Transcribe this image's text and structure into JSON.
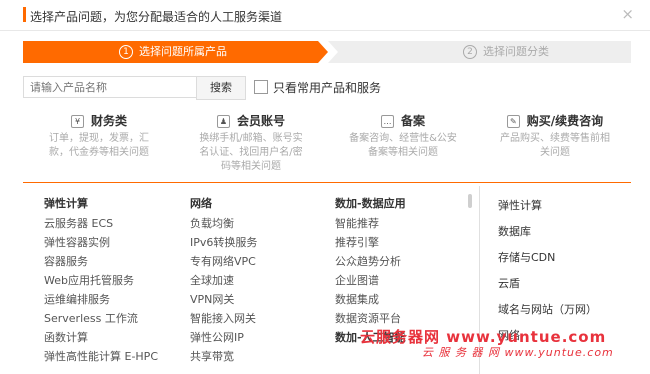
{
  "header": {
    "title": "选择产品问题，为您分配最适合的人工服务渠道",
    "close_icon": "×"
  },
  "steps": [
    {
      "num": "1",
      "label": "选择问题所属产品",
      "active": true
    },
    {
      "num": "2",
      "label": "选择问题分类",
      "active": false
    }
  ],
  "search": {
    "placeholder": "请输入产品名称",
    "button": "搜索",
    "checkbox_label": "只看常用产品和服务"
  },
  "categories": [
    {
      "icon": "¥",
      "icon_name": "yen-icon",
      "title": "财务类",
      "desc": "订单，提现，发票，汇款，代金券等相关问题"
    },
    {
      "icon": "♟",
      "icon_name": "user-icon",
      "title": "会员账号",
      "desc": "换绑手机/邮箱、账号实名认证、找回用户名/密码等相关问题"
    },
    {
      "icon": "…",
      "icon_name": "more-icon",
      "title": "备案",
      "desc": "备案咨询、经营性&公安备案等相关问题"
    },
    {
      "icon": "✎",
      "icon_name": "pencil-icon",
      "title": "购买/续费咨询",
      "desc": "产品购买、续费等售前相关问题"
    }
  ],
  "columns": [
    {
      "head": "弹性计算",
      "items": [
        "云服务器 ECS",
        "弹性容器实例",
        "容器服务",
        "Web应用托管服务",
        "运维编排服务",
        "Serverless 工作流",
        "函数计算",
        "弹性高性能计算 E-HPC"
      ]
    },
    {
      "head": "网络",
      "items": [
        "负载均衡",
        "IPv6转换服务",
        "专有网络VPC",
        "全球加速",
        "VPN网关",
        "智能接入网关",
        "弹性公网IP",
        "共享带宽"
      ]
    },
    {
      "head": "数加-数据应用",
      "items": [
        "智能推荐",
        "推荐引擎",
        "公众趋势分析",
        "企业图谱",
        "数据集成",
        "数据资源平台"
      ],
      "head2": "数加-人工智能"
    }
  ],
  "right_menu": [
    "弹性计算",
    "数据库",
    "存储与CDN",
    "云盾",
    "域名与网站（万网）",
    "网络"
  ],
  "watermark": {
    "line1": "云服务器网 www.yuntue.com",
    "line2": "云 服 务 器 网 www.yuntue.com"
  }
}
